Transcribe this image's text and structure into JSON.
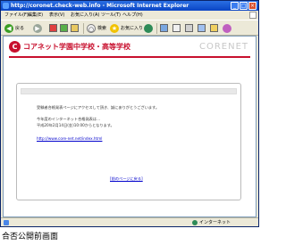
{
  "window": {
    "title": "http://coronet.check-web.info - Microsoft Internet Explorer"
  },
  "menu": [
    "ファイル(F)",
    "編集(E)",
    "表示(V)",
    "お気に入り(A)",
    "ツール(T)",
    "ヘルプ(H)"
  ],
  "toolbar": {
    "back_label": "戻る",
    "search_label": "検索",
    "favorites_label": "お気に入り"
  },
  "page": {
    "logo_text": "コアネット学園中学校・高等学校",
    "brand": "CORENET",
    "message_line1": "受験者合格発表ページにアクセスして頂き、誠にありがとうございます。",
    "message_line2": "今年度のインターネット合格発表は…",
    "message_line3": "平成20年2月14日(金)10:00からとなります。",
    "url_link": "http://www.core-net.net/index.html",
    "back_link": "[前のページに戻る]"
  },
  "status": {
    "zone": "インターネット"
  },
  "caption": "合否公開前画面",
  "colors": {
    "brand_red": "#c8102e",
    "titlebar_blue": "#0a44c4"
  }
}
